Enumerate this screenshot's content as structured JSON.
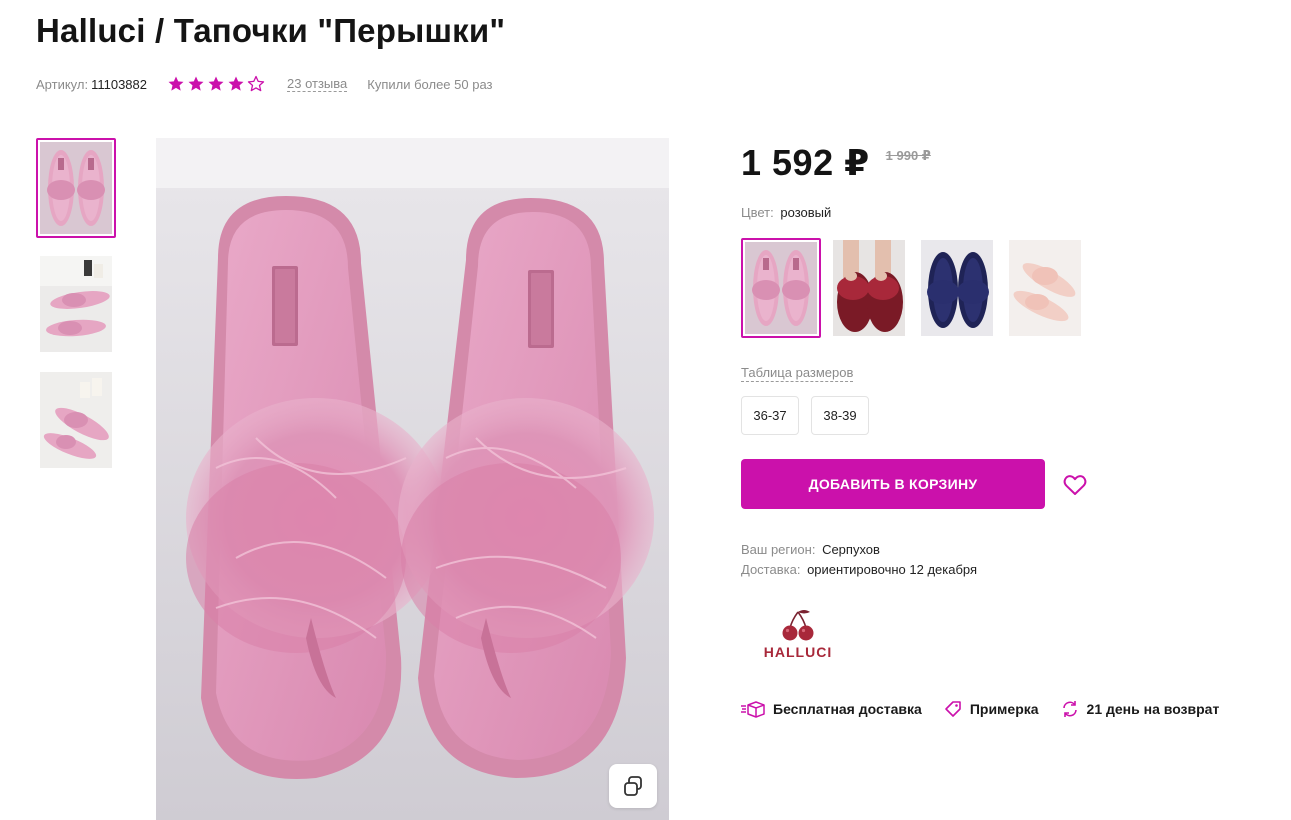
{
  "product": {
    "title": "Halluci / Тапочки \"Перышки\"",
    "article_label": "Артикул:",
    "article_value": "11103882",
    "rating": 4,
    "rating_max": 5,
    "reviews_text": "23 отзыва",
    "bought_text": "Купили более 50 раз"
  },
  "gallery": {
    "thumbnails": [
      {
        "alt": "pink-feather-slippers-top-view"
      },
      {
        "alt": "pink-slippers-on-floor"
      },
      {
        "alt": "pink-slippers-angle-view"
      }
    ],
    "copy_icon": "copy-icon"
  },
  "price": {
    "current": "1 592 ₽",
    "old": "1 990 ₽"
  },
  "color": {
    "label": "Цвет:",
    "value": "розовый",
    "options": [
      "pink",
      "burgundy",
      "navy",
      "peach"
    ]
  },
  "sizes": {
    "table_link": "Таблица размеров",
    "options": [
      "36-37",
      "38-39"
    ]
  },
  "actions": {
    "add_to_cart": "ДОБАВИТЬ В КОРЗИНУ",
    "wishlist_icon": "heart-icon"
  },
  "delivery": {
    "region_label": "Ваш регион:",
    "region_value": "Серпухов",
    "delivery_label": "Доставка:",
    "delivery_value": "ориентировочно 12 декабря"
  },
  "brand": {
    "name": "HALLUCI"
  },
  "features": [
    {
      "icon": "delivery-box-icon",
      "label": "Бесплатная доставка"
    },
    {
      "icon": "tag-icon",
      "label": "Примерка"
    },
    {
      "icon": "refresh-icon",
      "label": "21 день на возврат"
    }
  ],
  "colors": {
    "accent": "#cb11ab",
    "text": "#141414",
    "muted": "#8b8b8b",
    "brand": "#a8283a"
  }
}
